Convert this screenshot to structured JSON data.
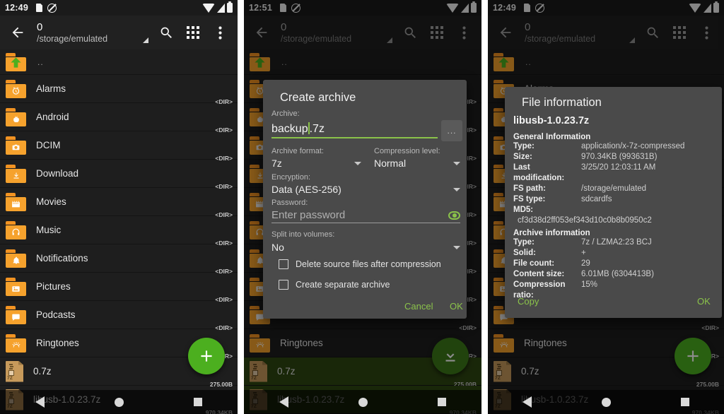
{
  "panels": [
    {
      "status": {
        "time": "12:49",
        "icons": [
          "sim-card-icon",
          "mute-icon",
          "wifi-icon",
          "signal-icon",
          "battery-icon"
        ]
      },
      "appbar": {
        "back": "back-arrow-icon",
        "title": "0",
        "subtitle": "/storage/emulated",
        "search": "search-icon",
        "grid": "apps-grid-icon",
        "overflow": "more-vert-icon"
      },
      "fab": {
        "icon": "plus-icon",
        "label": "+"
      }
    },
    {
      "status": {
        "time": "12:51"
      },
      "appbar": {
        "title": "0",
        "subtitle": "/storage/emulated"
      },
      "fab": {
        "icon": "download-icon",
        "label": ""
      }
    },
    {
      "status": {
        "time": "12:49"
      },
      "appbar": {
        "title": "0",
        "subtitle": "/storage/emulated"
      },
      "fab": {
        "icon": "plus-icon",
        "label": "+"
      }
    }
  ],
  "files": [
    {
      "name": "..",
      "type": "up",
      "meta": "",
      "icon": "folder-up-icon"
    },
    {
      "name": "Alarms",
      "type": "dir",
      "meta": "<DIR>",
      "icon": "folder-alarm-icon"
    },
    {
      "name": "Android",
      "type": "dir",
      "meta": "<DIR>",
      "icon": "folder-android-icon"
    },
    {
      "name": "DCIM",
      "type": "dir",
      "meta": "<DIR>",
      "icon": "folder-camera-icon"
    },
    {
      "name": "Download",
      "type": "dir",
      "meta": "<DIR>",
      "icon": "folder-download-icon"
    },
    {
      "name": "Movies",
      "type": "dir",
      "meta": "<DIR>",
      "icon": "folder-movie-icon"
    },
    {
      "name": "Music",
      "type": "dir",
      "meta": "<DIR>",
      "icon": "folder-music-icon"
    },
    {
      "name": "Notifications",
      "type": "dir",
      "meta": "<DIR>",
      "icon": "folder-bell-icon"
    },
    {
      "name": "Pictures",
      "type": "dir",
      "meta": "<DIR>",
      "icon": "folder-image-icon"
    },
    {
      "name": "Podcasts",
      "type": "dir",
      "meta": "<DIR>",
      "icon": "folder-podcast-icon"
    },
    {
      "name": "Ringtones",
      "type": "dir",
      "meta": "<DIR>",
      "icon": "folder-ringtone-icon"
    },
    {
      "name": "0.7z",
      "type": "file7z",
      "meta": "275.00B",
      "icon": "7z-file-icon"
    },
    {
      "name": "libusb-1.0.23.7z",
      "type": "file7z",
      "meta": "970.34KB",
      "icon": "7z-file-icon"
    }
  ],
  "create_archive": {
    "title": "Create archive",
    "archive_label": "Archive:",
    "archive_value_prefix": "backup",
    "archive_value_suffix": ".7z",
    "browse_label": "...",
    "format_label": "Archive format:",
    "format_value": "7z",
    "level_label": "Compression level:",
    "level_value": "Normal",
    "encryption_label": "Encryption:",
    "encryption_value": "Data (AES-256)",
    "password_label": "Password:",
    "password_placeholder": "Enter password",
    "split_label": "Split into volumes:",
    "split_value": "No",
    "checkbox_delete": "Delete source files after compression",
    "checkbox_separate": "Create separate archive",
    "cancel": "Cancel",
    "ok": "OK"
  },
  "file_information": {
    "title": "File information",
    "filename": "libusb-1.0.23.7z",
    "general_heading": "General Information",
    "general": [
      {
        "key": "Type:",
        "value": "application/x-7z-compressed"
      },
      {
        "key": "Size:",
        "value": "970.34KB (993631B)"
      },
      {
        "key": "Last modification:",
        "value": "3/25/20 12:03:11 AM"
      },
      {
        "key": "FS path:",
        "value": "/storage/emulated"
      },
      {
        "key": "FS type:",
        "value": "sdcardfs"
      },
      {
        "key": "MD5:",
        "value": ""
      }
    ],
    "md5_value": "cf3d38d2ff053ef343d10c0b8b0950c2",
    "archive_heading": "Archive information",
    "archive": [
      {
        "key": "Type:",
        "value": "7z / LZMA2:23 BCJ"
      },
      {
        "key": "Solid:",
        "value": "+"
      },
      {
        "key": "File count:",
        "value": "29"
      },
      {
        "key": "Content size:",
        "value": "6.01MB (6304413B)"
      },
      {
        "key": "Compression ratio:",
        "value": "15%"
      }
    ],
    "copy": "Copy",
    "ok": "OK"
  },
  "navbar": {
    "back": "nav-back-icon",
    "home": "nav-home-icon",
    "recents": "nav-recents-icon"
  },
  "colors": {
    "accent": "#8bc34a",
    "fab": "#4caf1f",
    "folder": "#f6a22d",
    "dialog_bg": "#4a4a4a",
    "selection": "#2f4712"
  }
}
